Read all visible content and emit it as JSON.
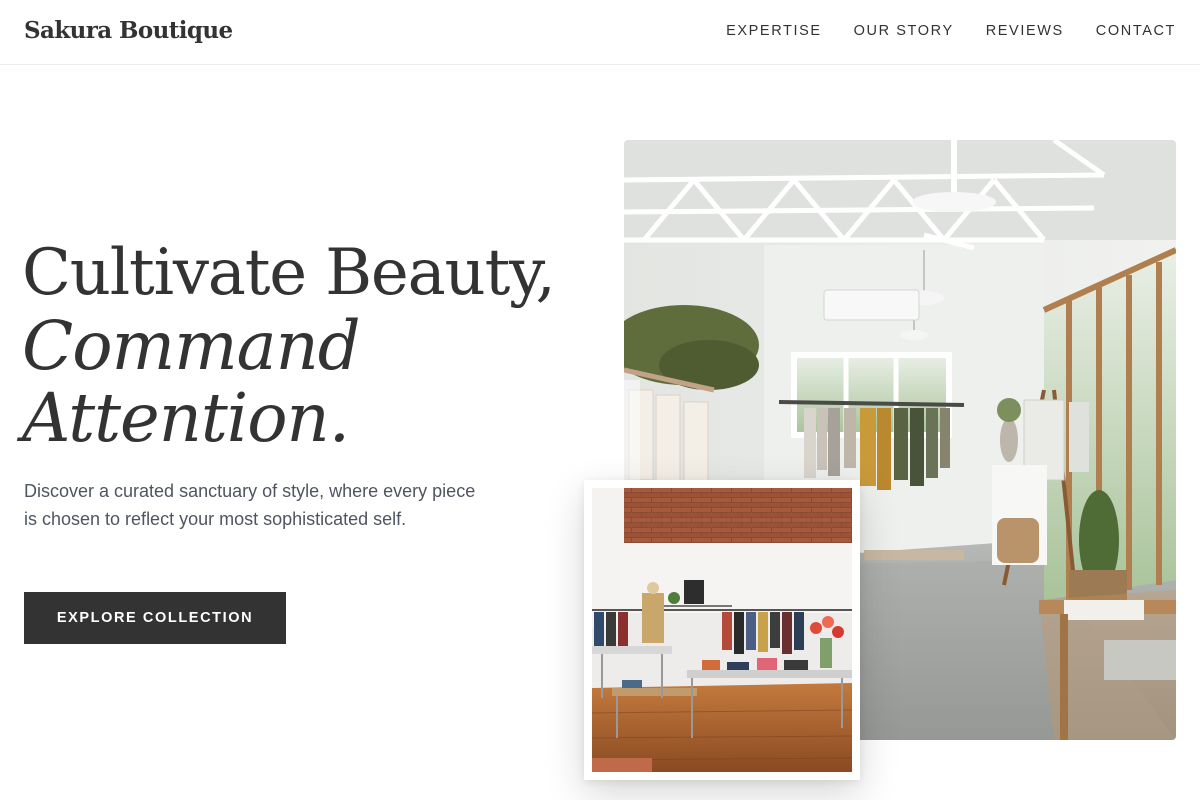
{
  "header": {
    "brand": "Sakura Boutique",
    "nav": [
      "EXPERTISE",
      "OUR STORY",
      "REVIEWS",
      "CONTACT"
    ]
  },
  "hero": {
    "title_line1": "Cultivate Beauty,",
    "title_line2": "Command",
    "title_line3": "Attention.",
    "description": "Discover a curated sanctuary of style, where every piece is chosen to reflect your most sophisticated self.",
    "cta_label": "EXPLORE COLLECTION"
  },
  "colors": {
    "text": "#333333",
    "muted_text": "#4f5560",
    "button_bg": "#333333",
    "button_text": "#ffffff",
    "background": "#ffffff"
  }
}
